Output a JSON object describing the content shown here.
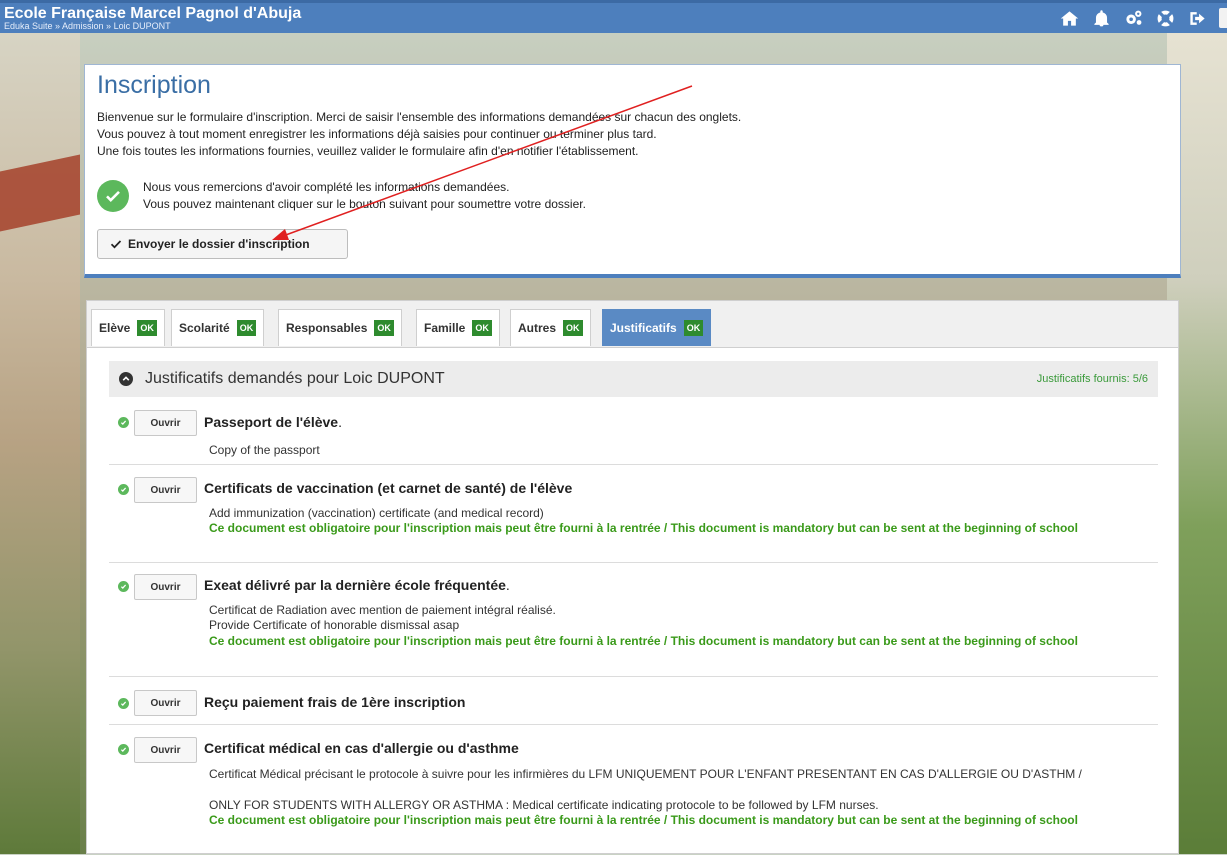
{
  "header": {
    "title": "Ecole Française Marcel Pagnol d'Abuja",
    "breadcrumb": "Eduka Suite » Admission » Loic DUPONT",
    "icons": [
      "home-icon",
      "bell-icon",
      "cogs-icon",
      "help-ring-icon",
      "sign-out-icon"
    ]
  },
  "inscription": {
    "title": "Inscription",
    "intro_line1": "Bienvenue sur le formulaire d'inscription. Merci de saisir l'ensemble des informations demandées sur chacun des onglets.",
    "intro_line2": "Vous pouvez à tout moment enregistrer les informations déjà saisies pour continuer ou terminer plus tard.",
    "intro_line3": "Une fois toutes les informations fournies, veuillez valider le formulaire afin d'en notifier l'établissement.",
    "thanks_line1": "Nous vous remercions d'avoir complété les informations demandées.",
    "thanks_line2": "Vous pouvez maintenant cliquer sur le bouton suivant pour soumettre votre dossier.",
    "send_button": "Envoyer le dossier d'inscription"
  },
  "tabs": [
    {
      "label": "Elève",
      "badge": "OK",
      "active": false
    },
    {
      "label": "Scolarité",
      "badge": "OK",
      "active": false
    },
    {
      "label": "Responsables",
      "badge": "OK",
      "active": false
    },
    {
      "label": "Famille",
      "badge": "OK",
      "active": false
    },
    {
      "label": "Autres",
      "badge": "OK",
      "active": false
    },
    {
      "label": "Justificatifs",
      "badge": "OK",
      "active": true
    }
  ],
  "section": {
    "title": "Justificatifs demandés pour Loic DUPONT",
    "count": "Justificatifs fournis: 5/6"
  },
  "open_label": "Ouvrir",
  "documents": [
    {
      "name": "Passeport de l'élève",
      "suffix": ".",
      "desc1": "Copy of the passport"
    },
    {
      "name": "Certificats de vaccination (et carnet de santé) de l'élève",
      "desc1": "Add immunization (vaccination) certificate (and medical record)",
      "required": "Ce document est obligatoire pour l'inscription mais peut être fourni à la rentrée / This document is mandatory but can be sent at the beginning of school"
    },
    {
      "name": "Exeat délivré par la dernière école fréquentée",
      "suffix": ".",
      "desc1": "Certificat de Radiation avec mention de paiement intégral réalisé.",
      "desc2": "Provide Certificate of honorable dismissal asap",
      "required": "Ce document est obligatoire pour l'inscription mais peut être fourni à la rentrée / This document is mandatory but can be sent at the beginning of school"
    },
    {
      "name": "Reçu paiement frais de 1ère inscription"
    },
    {
      "name": "Certificat médical en cas d'allergie ou d'asthme",
      "desc1": "Certificat Médical précisant le protocole à suivre pour les infirmières du LFM UNIQUEMENT POUR L'ENFANT PRESENTANT EN CAS D'ALLERGIE OU D'ASTHM /",
      "desc2": "ONLY FOR STUDENTS WITH ALLERGY OR ASTHMA : Medical certificate indicating protocole to be followed by LFM nurses.",
      "required": "Ce document est obligatoire pour l'inscription mais peut être fourni à la rentrée / This document is mandatory but can be sent at the beginning of school"
    }
  ],
  "colors": {
    "topbar": "#4d7fbd",
    "active_tab": "#5a8ac4",
    "ok_badge": "#2e8b2e",
    "success": "#5cb85c",
    "required_text": "#3a9a1a",
    "annotation_arrow": "#e02020"
  }
}
